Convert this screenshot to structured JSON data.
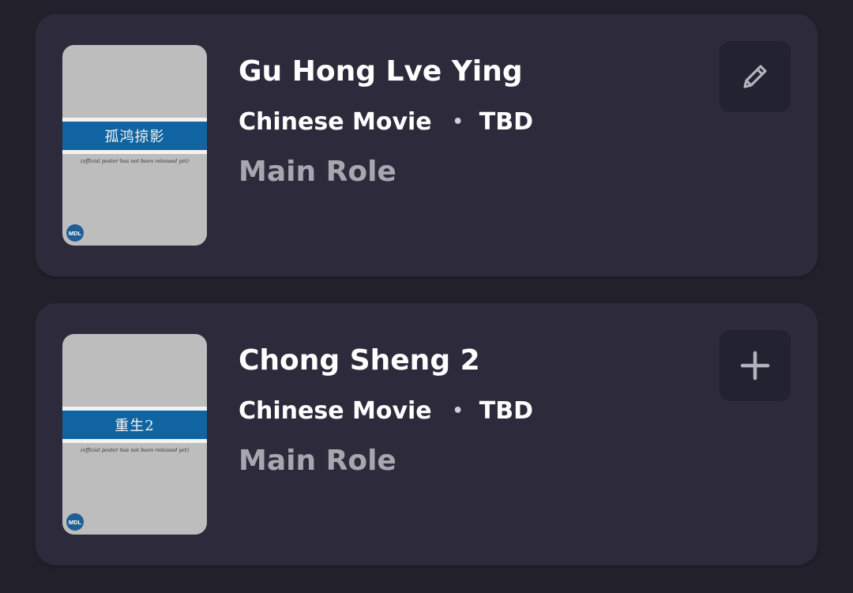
{
  "cards": [
    {
      "title": "Gu Hong Lve Ying",
      "type": "Chinese Movie",
      "separator": "•",
      "status": "TBD",
      "role": "Main Role",
      "poster": {
        "title_text": "孤鸿掠影",
        "note": "(official poster has not been released yet)",
        "logo": "MDL"
      },
      "action": {
        "icon": "pencil-icon"
      }
    },
    {
      "title": "Chong Sheng 2",
      "type": "Chinese Movie",
      "separator": "•",
      "status": "TBD",
      "role": "Main Role",
      "poster": {
        "title_text": "重生2",
        "note": "(official poster has not been released yet)",
        "logo": "MDL"
      },
      "action": {
        "icon": "plus-icon"
      }
    }
  ],
  "colors": {
    "background": "#22212b",
    "card": "#2d2b3b",
    "button": "#232230",
    "poster_band": "#0f64a1",
    "role_text": "#a8a6ae"
  }
}
